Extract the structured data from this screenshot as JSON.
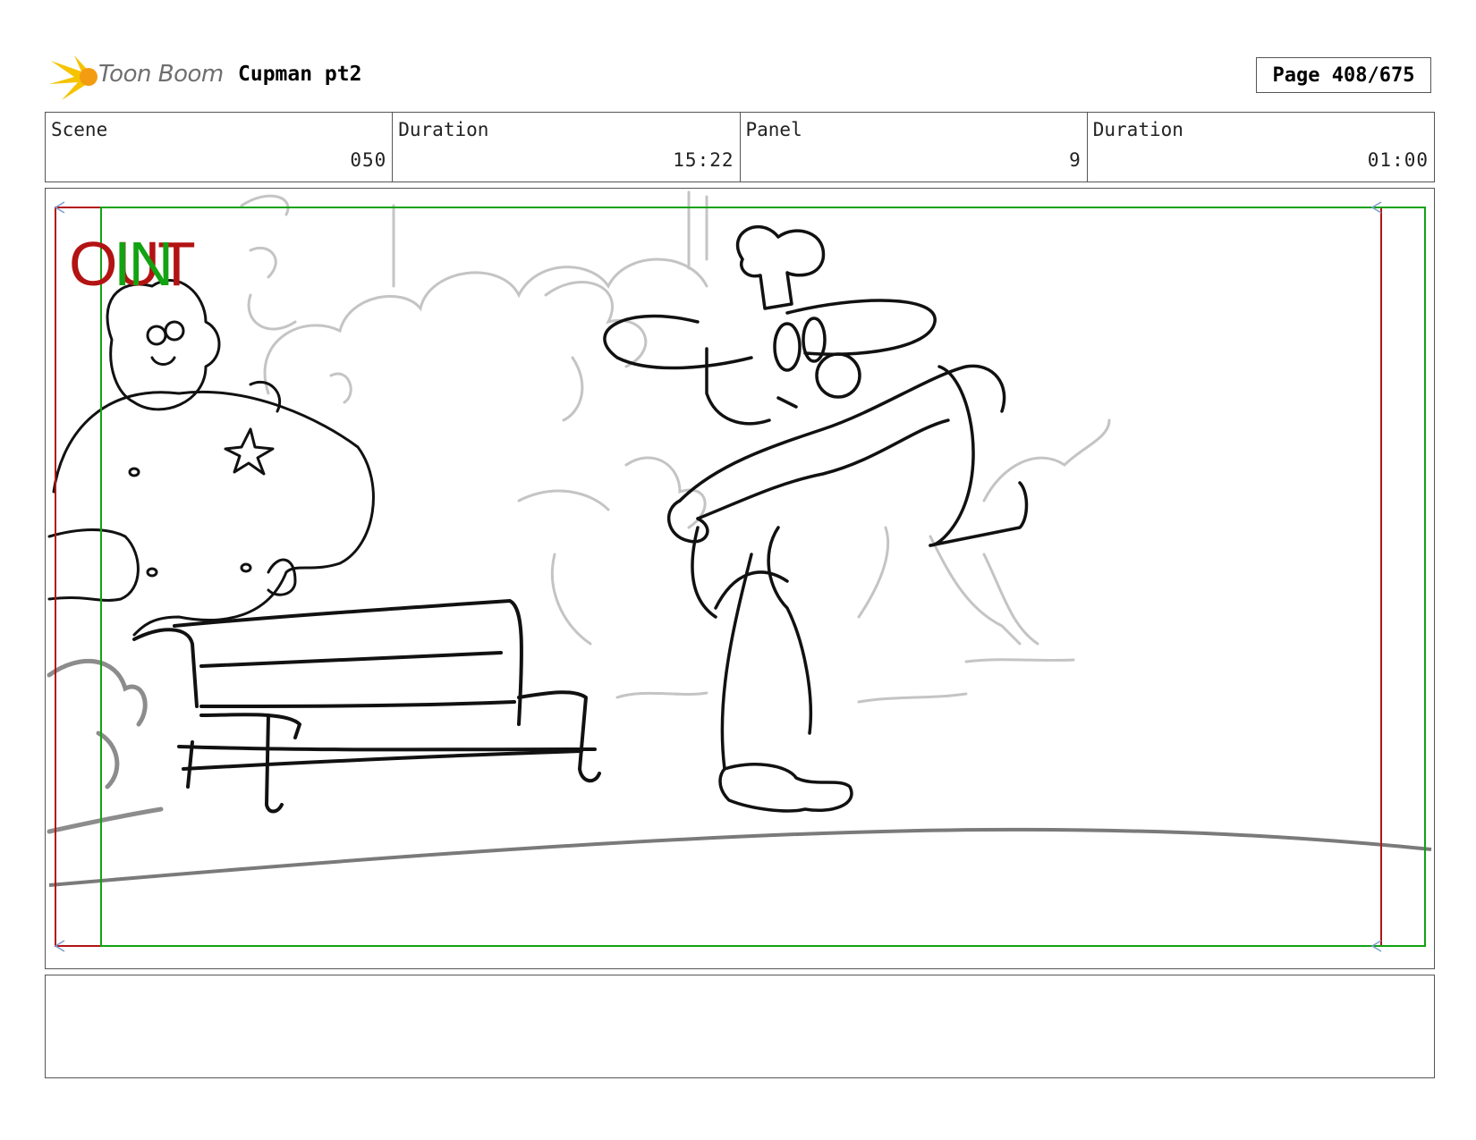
{
  "header": {
    "logo_text": "Toon Boom",
    "project_title": "Cupman pt2",
    "page_label": "Page 408/675"
  },
  "info": {
    "scene_label": "Scene",
    "scene_value": "050",
    "scene_duration_label": "Duration",
    "scene_duration_value": "15:22",
    "panel_label": "Panel",
    "panel_value": "9",
    "panel_duration_label": "Duration",
    "panel_duration_value": "01:00"
  },
  "panel": {
    "out_marker": "OUT",
    "in_marker": "IN",
    "colors": {
      "out_frame": "#b31313",
      "in_frame": "#12a312"
    }
  },
  "notes": {
    "text": ""
  }
}
